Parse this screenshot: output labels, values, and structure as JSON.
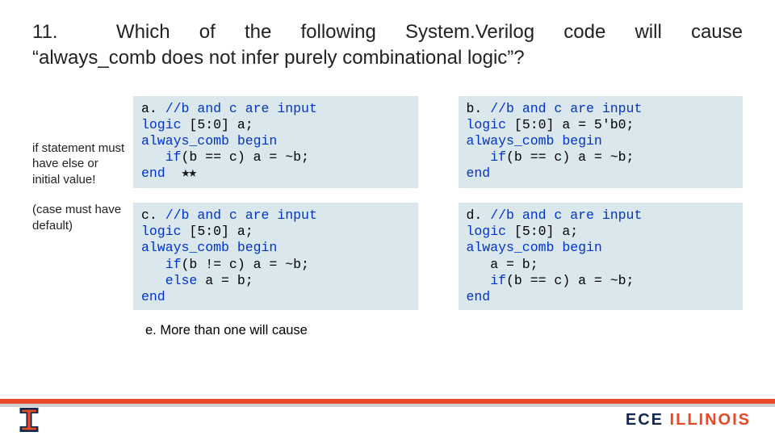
{
  "question": {
    "number": "11.",
    "line1": "Which of the following System.Verilog code will cause",
    "line2": "“always_comb does not infer purely combinational logic”?"
  },
  "sidenote": {
    "p1": "if statement must have else or initial value!",
    "p2": "(case must have default)"
  },
  "options": {
    "a": {
      "label": "a.",
      "comment": "//b and c are input",
      "l2a": "logic",
      "l2b": " [5:0] a;",
      "l3a": "always_comb begin",
      "l4a": "   if",
      "l4b": "(b == c) a = ~b;",
      "l5a": "end",
      "stars": "★★"
    },
    "b": {
      "label": "b.",
      "comment": "//b and c are input",
      "l2a": "logic",
      "l2b": " [5:0] a = 5'b0;",
      "l3a": "always_comb begin",
      "l4a": "   if",
      "l4b": "(b == c) a = ~b;",
      "l5a": "end"
    },
    "c": {
      "label": "c.",
      "comment": "//b and c are input",
      "l2a": "logic",
      "l2b": " [5:0] a;",
      "l3a": "always_comb begin",
      "l4a": "   if",
      "l4b": "(b != c) a = ~b;",
      "l5a": "   else",
      "l5b": " a = b;",
      "l6a": "end"
    },
    "d": {
      "label": "d.",
      "comment": "//b and c are input",
      "l2a": "logic",
      "l2b": " [5:0] a;",
      "l3a": "always_comb begin",
      "l4": "   a = b;",
      "l5a": "   if",
      "l5b": "(b == c) a = ~b;",
      "l6a": "end"
    },
    "e": "e. More than one will cause"
  },
  "footer": {
    "ece": "ECE ",
    "illinois": "ILLINOIS"
  }
}
